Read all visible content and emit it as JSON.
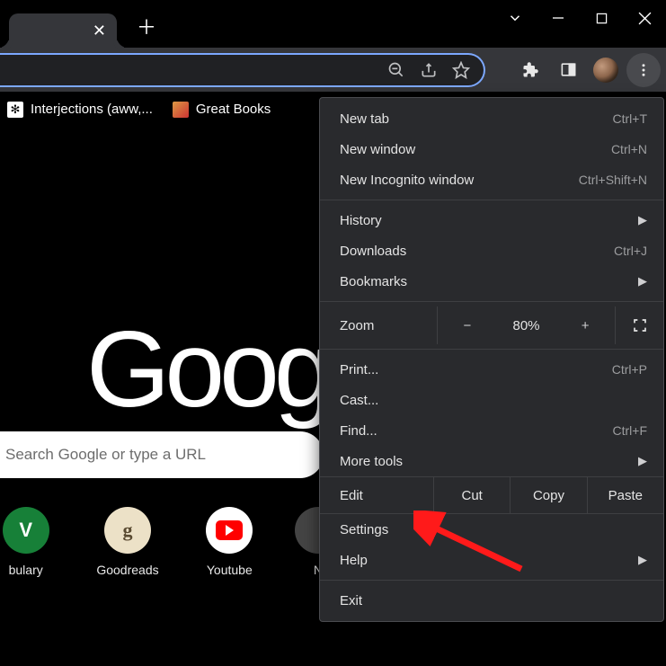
{
  "bookmarks": {
    "items": [
      {
        "label": "Interjections (aww,..."
      },
      {
        "label": "Great Books"
      }
    ]
  },
  "content": {
    "logo_text": "Goog",
    "search_placeholder": "Search Google or type a URL",
    "shortcuts": [
      {
        "label": "bulary"
      },
      {
        "label": "Goodreads"
      },
      {
        "label": "Youtube"
      },
      {
        "label": "N"
      }
    ]
  },
  "menu": {
    "new_tab": {
      "label": "New tab",
      "shortcut": "Ctrl+T"
    },
    "new_window": {
      "label": "New window",
      "shortcut": "Ctrl+N"
    },
    "incognito": {
      "label": "New Incognito window",
      "shortcut": "Ctrl+Shift+N"
    },
    "history": {
      "label": "History"
    },
    "downloads": {
      "label": "Downloads",
      "shortcut": "Ctrl+J"
    },
    "bookmarks": {
      "label": "Bookmarks"
    },
    "zoom": {
      "label": "Zoom",
      "value": "80%"
    },
    "zoom_minus": "−",
    "zoom_plus": "+",
    "print": {
      "label": "Print...",
      "shortcut": "Ctrl+P"
    },
    "cast": {
      "label": "Cast..."
    },
    "find": {
      "label": "Find...",
      "shortcut": "Ctrl+F"
    },
    "more_tools": {
      "label": "More tools"
    },
    "edit": {
      "label": "Edit",
      "cut": "Cut",
      "copy": "Copy",
      "paste": "Paste"
    },
    "settings": {
      "label": "Settings"
    },
    "help": {
      "label": "Help"
    },
    "exit": {
      "label": "Exit"
    }
  }
}
